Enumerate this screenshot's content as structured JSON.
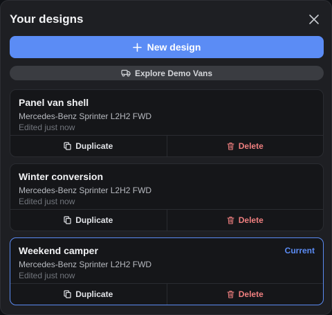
{
  "header": {
    "title": "Your designs"
  },
  "actions": {
    "new_design_label": "New design",
    "explore_label": "Explore Demo Vans"
  },
  "designs": [
    {
      "name": "Panel van shell",
      "model": "Mercedes-Benz Sprinter L2H2 FWD",
      "edited": "Edited just now",
      "badge": "",
      "duplicate_label": "Duplicate",
      "delete_label": "Delete"
    },
    {
      "name": "Winter conversion",
      "model": "Mercedes-Benz Sprinter L2H2 FWD",
      "edited": "Edited just now",
      "badge": "",
      "duplicate_label": "Duplicate",
      "delete_label": "Delete"
    },
    {
      "name": "Weekend camper",
      "model": "Mercedes-Benz Sprinter L2H2 FWD",
      "edited": "Edited just now",
      "badge": "Current",
      "duplicate_label": "Duplicate",
      "delete_label": "Delete"
    }
  ],
  "colors": {
    "accent": "#5b8cf5",
    "danger": "#ef7f7f"
  },
  "icons": {
    "close": "close-icon",
    "add": "plus-icon",
    "explore": "truck-icon",
    "duplicate": "copy-icon",
    "delete": "trash-icon"
  }
}
